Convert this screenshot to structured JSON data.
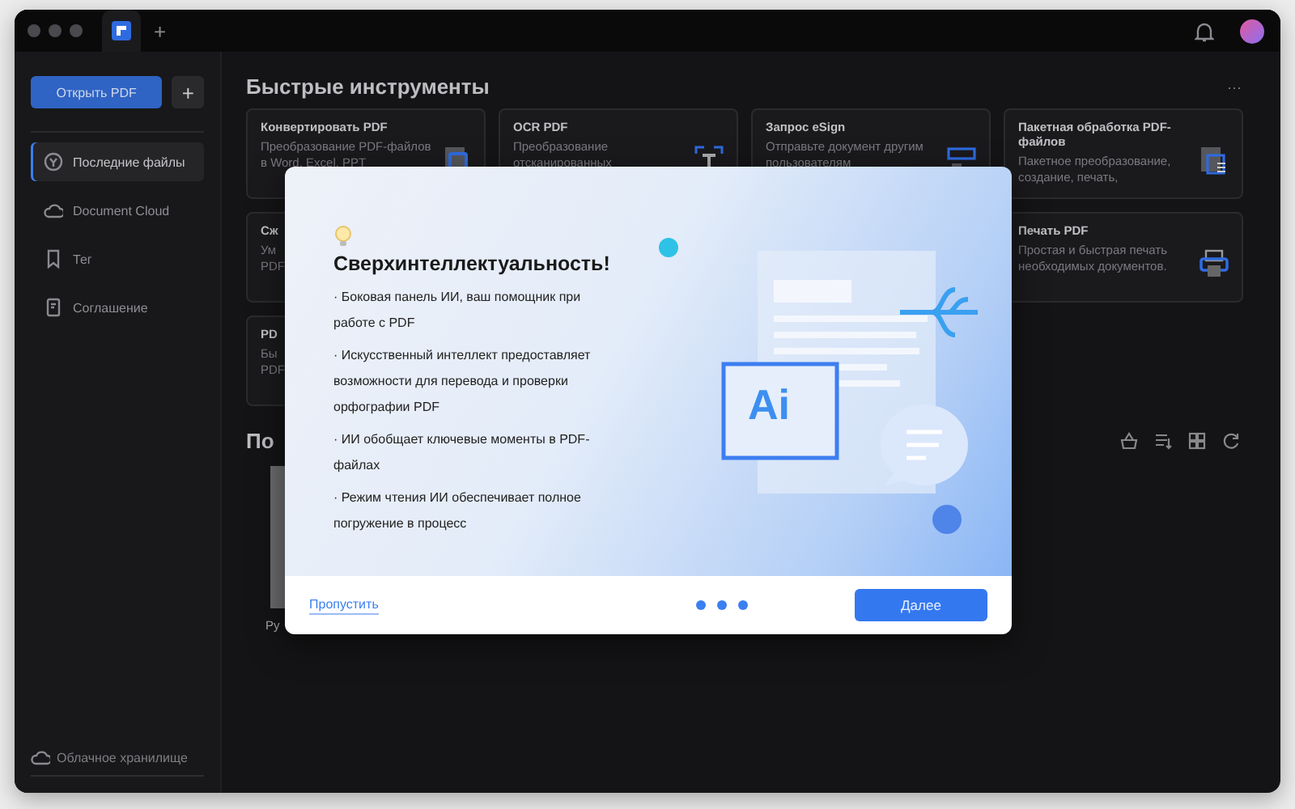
{
  "titlebar": {
    "new_tab": "+"
  },
  "sidebar": {
    "open_button": "Открыть PDF",
    "add_button": "+",
    "items": [
      {
        "label": "Последние файлы",
        "selected": true
      },
      {
        "label": "Document Cloud",
        "selected": false
      },
      {
        "label": "Тег",
        "selected": false
      },
      {
        "label": "Соглашение",
        "selected": false
      }
    ],
    "storage": "Облачное хранилище"
  },
  "quick_tools": {
    "title": "Быстрые инструменты",
    "more": "···",
    "cards": [
      {
        "title": "Конвертировать PDF",
        "description": "Преобразование PDF-файлов в Word, Excel, PPT"
      },
      {
        "title": "OCR PDF",
        "description": "Преобразование отсканированных"
      },
      {
        "title": "Запрос eSign",
        "description": "Отправьте документ другим пользователям"
      },
      {
        "title": "Пакетная обработка PDF-файлов",
        "description": "Пакетное преобразование, создание, печать,"
      },
      {
        "title": "Сж",
        "description": "Ум PDF"
      },
      {
        "title": "Печать PDF",
        "description": "Простая и быстрая печать необходимых документов."
      },
      {
        "title": "PD",
        "description": "Бы PDF"
      }
    ]
  },
  "recent": {
    "title": "По",
    "files": [
      {
        "name": "Ру"
      }
    ]
  },
  "dialog": {
    "title": "Сверхинтеллектуальность!",
    "ai_label": "Ai",
    "bullets": [
      "· Боковая панель ИИ, ваш помощник при работе с PDF",
      "· Искусственный интеллект предоставляет возможности для перевода и проверки орфографии PDF",
      "· ИИ обобщает ключевые моменты в PDF-файлах",
      "· Режим чтения ИИ обеспечивает полное погружение в процесс"
    ],
    "skip": "Пропустить",
    "next": "Далее"
  }
}
